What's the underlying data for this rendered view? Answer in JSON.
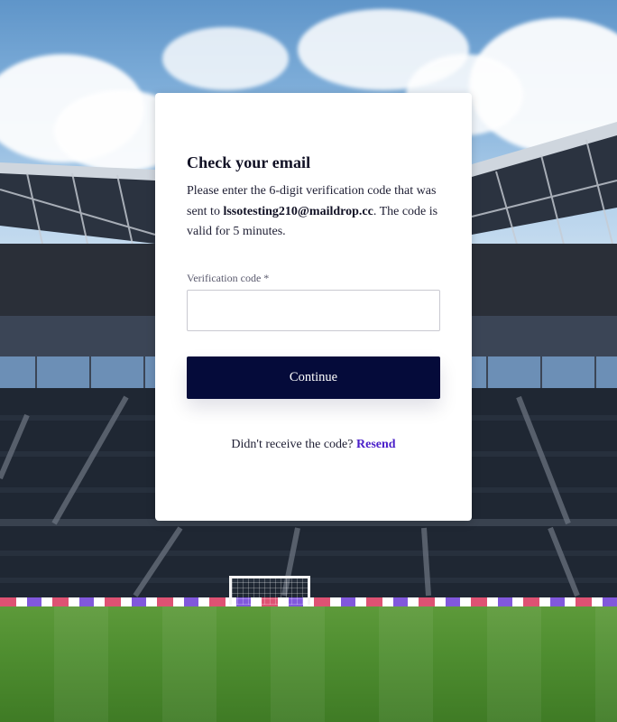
{
  "page": {
    "background": "stadium-photo"
  },
  "card": {
    "title": "Check your email",
    "description_before": "Please enter the 6-digit verification code that was sent to ",
    "email": "lssotesting210@maildrop.cc",
    "description_after": ". The code is valid for 5 minutes.",
    "verification_label": "Verification code",
    "required_marker": "*",
    "verification_value": "",
    "continue_label": "Continue",
    "resend_prompt": "Didn't receive the code?",
    "resend_label": "Resend"
  },
  "colors": {
    "primary_button": "#050b3a",
    "link": "#4a1fc9",
    "card_bg": "#ffffff"
  }
}
